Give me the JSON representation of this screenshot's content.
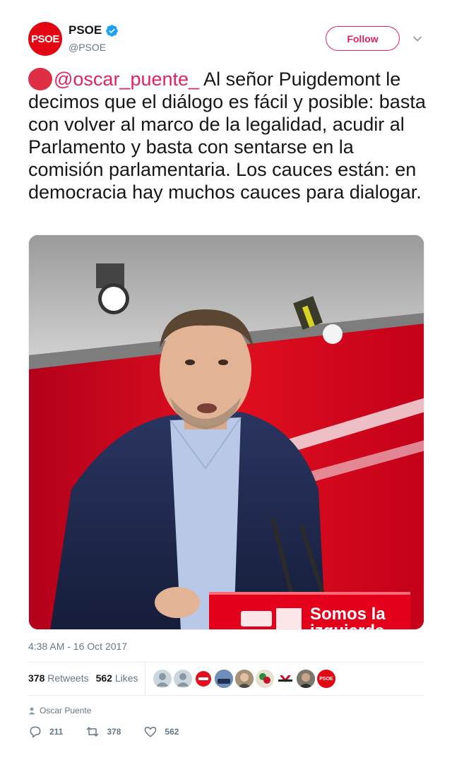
{
  "author": {
    "display_name": "PSOE",
    "handle": "@PSOE",
    "avatar_text": "PSOE",
    "verified": true
  },
  "follow_label": "Follow",
  "tweet": {
    "mention": "@oscar_puente_",
    "text": " Al señor Puigdemont le decimos que el diálogo es fácil y posible: basta con volver al marco de la legalidad, acudir al Parlamento y basta con sentarse en la comisión parlamentaria. Los cauces están: en democracia hay muchos cauces para dialogar.",
    "emoji": "red-circle"
  },
  "photo": {
    "podium_text_line1": "Somos la",
    "podium_text_line2": "izquierda",
    "podium_logo": "PSOE"
  },
  "timestamp": "4:38 AM - 16 Oct 2017",
  "stats": {
    "retweets_count": "378",
    "retweets_label": "Retweets",
    "likes_count": "562",
    "likes_label": "Likes"
  },
  "likers": [
    "avatar-default",
    "avatar-default",
    "avatar-no-entry",
    "avatar-photo",
    "avatar-photo",
    "avatar-photo",
    "avatar-logo",
    "avatar-photo",
    "avatar-psoe"
  ],
  "liker_psoe_text": "PSOE",
  "credit": "Oscar Puente",
  "actions": {
    "replies": "211",
    "retweets": "378",
    "likes": "562"
  },
  "colors": {
    "accent": "#e0245e",
    "brand_red": "#e30613",
    "verified_blue": "#1da1f2"
  }
}
